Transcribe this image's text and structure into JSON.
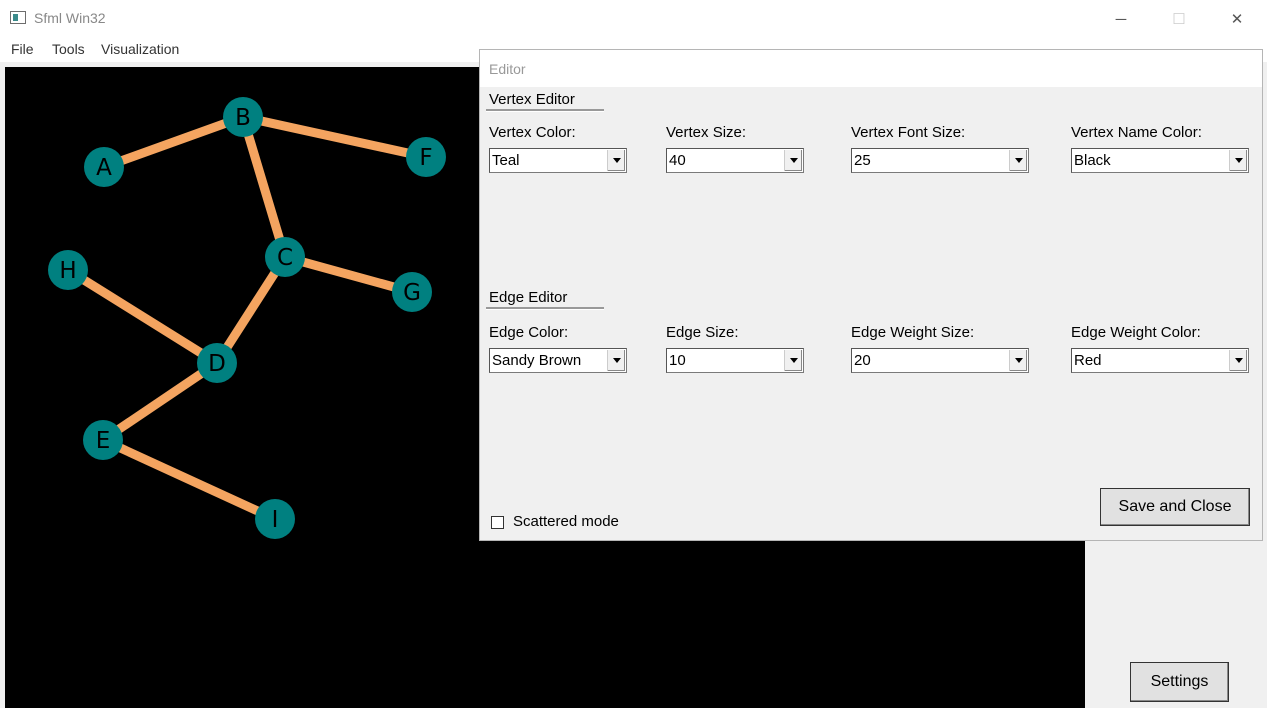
{
  "window": {
    "title": "Sfml Win32",
    "controls": {
      "minimize": "─",
      "maximize": "☐",
      "close": "✕"
    }
  },
  "menu": {
    "items": [
      "File",
      "Tools",
      "Visualization"
    ]
  },
  "graph": {
    "vertex_color": "#008080",
    "edge_color": "#f4a460",
    "label_color": "#000000",
    "vertices": [
      {
        "name": "A"
      },
      {
        "name": "B"
      },
      {
        "name": "F"
      },
      {
        "name": "C"
      },
      {
        "name": "H"
      },
      {
        "name": "G"
      },
      {
        "name": "D"
      },
      {
        "name": "E"
      },
      {
        "name": "I"
      }
    ],
    "edges": [
      [
        "A",
        "B"
      ],
      [
        "B",
        "F"
      ],
      [
        "B",
        "C"
      ],
      [
        "C",
        "G"
      ],
      [
        "C",
        "D"
      ],
      [
        "H",
        "D"
      ],
      [
        "D",
        "E"
      ],
      [
        "E",
        "I"
      ]
    ]
  },
  "settings_button": {
    "label": "Settings"
  },
  "editor": {
    "title": "Editor",
    "vertex_section": {
      "title": "Vertex Editor",
      "fields": [
        {
          "label": "Vertex Color:",
          "value": "Teal"
        },
        {
          "label": "Vertex Size:",
          "value": "40"
        },
        {
          "label": "Vertex Font Size:",
          "value": "25"
        },
        {
          "label": "Vertex Name Color:",
          "value": "Black"
        }
      ]
    },
    "edge_section": {
      "title": "Edge Editor",
      "fields": [
        {
          "label": "Edge Color:",
          "value": "Sandy Brown"
        },
        {
          "label": "Edge Size:",
          "value": "10"
        },
        {
          "label": "Edge Weight Size:",
          "value": "20"
        },
        {
          "label": "Edge Weight Color:",
          "value": "Red"
        }
      ]
    },
    "scattered_mode": {
      "label": "Scattered mode",
      "checked": false
    },
    "save_button": {
      "label": "Save and Close"
    }
  }
}
